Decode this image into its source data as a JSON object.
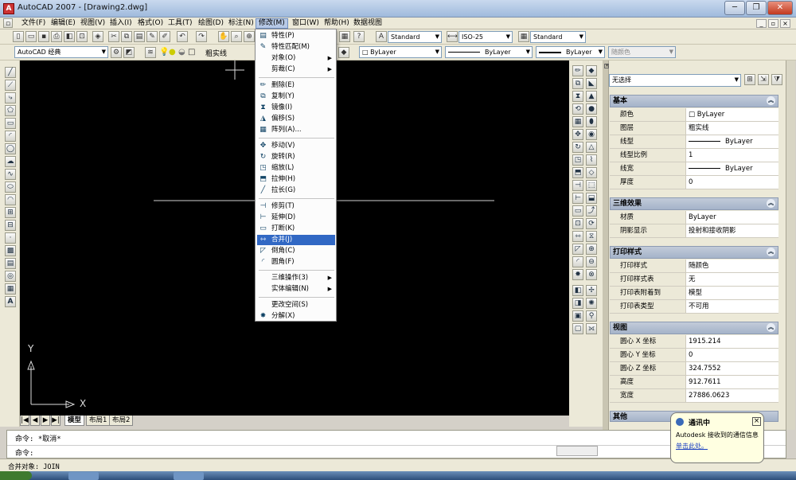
{
  "title_bar": {
    "app_title": "AutoCAD 2007 - [Drawing2.dwg]",
    "minimize": "─",
    "restore": "❐",
    "close": "✕"
  },
  "menubar": {
    "items": [
      "文件(F)",
      "编辑(E)",
      "视图(V)",
      "插入(I)",
      "格式(O)",
      "工具(T)",
      "绘图(D)",
      "标注(N)",
      "修改(M)",
      "窗口(W)",
      "帮助(H)",
      "数据视图"
    ],
    "active": "修改(M)"
  },
  "toolbar": {
    "text_style": "Standard",
    "dim_style": "ISO-25",
    "table_style": "Standard",
    "workspace": "AutoCAD 经典",
    "layer": "粗实线",
    "color_control": "ByLayer",
    "linetype_control": "ByLayer",
    "lineweight_control": "ByLayer",
    "plotstyle_control": "随颜色"
  },
  "modify_menu": {
    "items": [
      {
        "label": "特性(P)",
        "icon": "properties-icon"
      },
      {
        "label": "特性匹配(M)",
        "icon": "match-properties-icon"
      },
      {
        "label": "对象(O)",
        "submenu": true
      },
      {
        "label": "剪裁(C)",
        "submenu": true
      },
      {
        "label": "删除(E)",
        "icon": "erase-icon"
      },
      {
        "label": "复制(Y)",
        "icon": "copy-icon"
      },
      {
        "label": "镜像(I)",
        "icon": "mirror-icon"
      },
      {
        "label": "偏移(S)",
        "icon": "offset-icon"
      },
      {
        "label": "阵列(A)...",
        "icon": "array-icon"
      },
      {
        "label": "移动(V)",
        "icon": "move-icon"
      },
      {
        "label": "旋转(R)",
        "icon": "rotate-icon"
      },
      {
        "label": "缩放(L)",
        "icon": "scale-icon"
      },
      {
        "label": "拉伸(H)",
        "icon": "stretch-icon"
      },
      {
        "label": "拉长(G)",
        "icon": "lengthen-icon"
      },
      {
        "label": "修剪(T)",
        "icon": "trim-icon"
      },
      {
        "label": "延伸(D)",
        "icon": "extend-icon"
      },
      {
        "label": "打断(K)",
        "icon": "break-icon"
      },
      {
        "label": "合并(J)",
        "icon": "join-icon",
        "highlighted": true
      },
      {
        "label": "倒角(C)",
        "icon": "chamfer-icon"
      },
      {
        "label": "圆角(F)",
        "icon": "fillet-icon"
      },
      {
        "label": "三维操作(3)",
        "submenu": true
      },
      {
        "label": "实体编辑(N)",
        "submenu": true
      },
      {
        "label": "更改空间(S)"
      },
      {
        "label": "分解(X)",
        "icon": "explode-icon"
      }
    ]
  },
  "properties": {
    "selection": "无选择",
    "sections": {
      "basic": {
        "title": "基本",
        "rows": [
          {
            "name": "颜色",
            "value": "ByLayer"
          },
          {
            "name": "图层",
            "value": "粗实线"
          },
          {
            "name": "线型",
            "value": "ByLayer"
          },
          {
            "name": "线型比例",
            "value": "1"
          },
          {
            "name": "线宽",
            "value": "ByLayer"
          },
          {
            "name": "厚度",
            "value": "0"
          }
        ]
      },
      "three_d": {
        "title": "三维效果",
        "rows": [
          {
            "name": "材质",
            "value": "ByLayer"
          },
          {
            "name": "阴影显示",
            "value": "投射和接收阴影"
          }
        ]
      },
      "plot": {
        "title": "打印样式",
        "rows": [
          {
            "name": "打印样式",
            "value": "随颜色"
          },
          {
            "name": "打印样式表",
            "value": "无"
          },
          {
            "name": "打印表附着到",
            "value": "模型"
          },
          {
            "name": "打印表类型",
            "value": "不可用"
          }
        ]
      },
      "view": {
        "title": "视图",
        "rows": [
          {
            "name": "圆心 X 坐标",
            "value": "1915.214"
          },
          {
            "name": "圆心 Y 坐标",
            "value": "0"
          },
          {
            "name": "圆心 Z 坐标",
            "value": "324.7552"
          },
          {
            "name": "高度",
            "value": "912.7611"
          },
          {
            "name": "宽度",
            "value": "27886.0623"
          }
        ]
      },
      "misc": {
        "title": "其他"
      }
    }
  },
  "layout_tabs": [
    "模型",
    "布局1",
    "布局2"
  ],
  "command_lines": [
    "命令: *取消*",
    "命令:"
  ],
  "status_text": "合并对象: JOIN",
  "balloon": {
    "line1": "通讯中",
    "line2": "Autodesk 接收到的通信信息",
    "link": "单击此处。"
  },
  "axes": {
    "x": "X",
    "y": "Y"
  },
  "colors": {
    "drawing_bg": "#000000",
    "menu_highlight": "#3168c4"
  }
}
